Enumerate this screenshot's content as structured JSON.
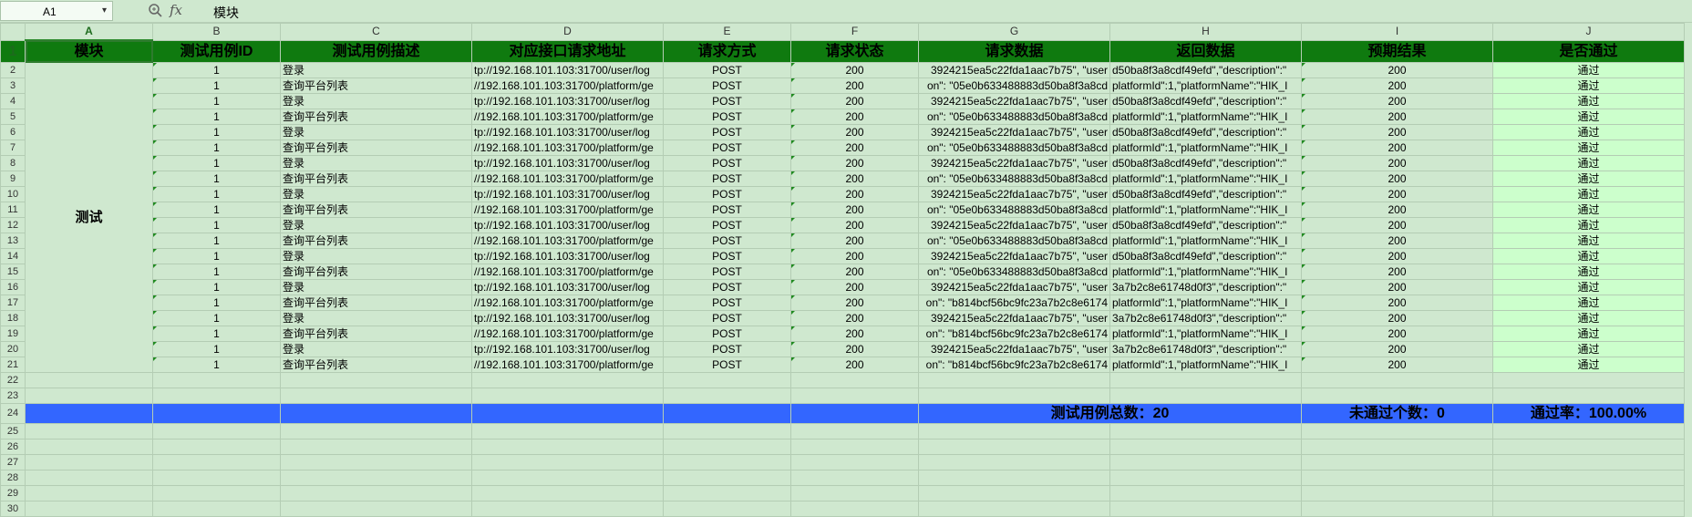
{
  "formula_bar": {
    "cell_ref": "A1",
    "dropdown_icon": "chevron-down",
    "zoom_icon": "magnifier",
    "fx_label": "fx",
    "value": "模块"
  },
  "columns": [
    "A",
    "B",
    "C",
    "D",
    "E",
    "F",
    "G",
    "H",
    "I",
    "J"
  ],
  "header": [
    "模块",
    "测试用例ID",
    "测试用例描述",
    "对应接口请求地址",
    "请求方式",
    "请求状态",
    "请求数据",
    "返回数据",
    "预期结果",
    "是否通过"
  ],
  "module_label": "测试",
  "rows": [
    {
      "num": "2",
      "id": "1",
      "desc": "登录",
      "url": "tp://192.168.101.103:31700/user/log",
      "method": "POST",
      "status": "200",
      "req": "3924215ea5c22fda1aac7b75\", \"user",
      "resp": "d50ba8f3a8cdf49efd\",\"description\":\"",
      "expected": "200",
      "pass": "通过"
    },
    {
      "num": "3",
      "id": "1",
      "desc": "查询平台列表",
      "url": "//192.168.101.103:31700/platform/ge",
      "method": "POST",
      "status": "200",
      "req": "on\": \"05e0b633488883d50ba8f3a8cd",
      "resp": "platformId\":1,\"platformName\":\"HIK_I",
      "expected": "200",
      "pass": "通过"
    },
    {
      "num": "4",
      "id": "1",
      "desc": "登录",
      "url": "tp://192.168.101.103:31700/user/log",
      "method": "POST",
      "status": "200",
      "req": "3924215ea5c22fda1aac7b75\", \"user",
      "resp": "d50ba8f3a8cdf49efd\",\"description\":\"",
      "expected": "200",
      "pass": "通过"
    },
    {
      "num": "5",
      "id": "1",
      "desc": "查询平台列表",
      "url": "//192.168.101.103:31700/platform/ge",
      "method": "POST",
      "status": "200",
      "req": "on\": \"05e0b633488883d50ba8f3a8cd",
      "resp": "platformId\":1,\"platformName\":\"HIK_I",
      "expected": "200",
      "pass": "通过"
    },
    {
      "num": "6",
      "id": "1",
      "desc": "登录",
      "url": "tp://192.168.101.103:31700/user/log",
      "method": "POST",
      "status": "200",
      "req": "3924215ea5c22fda1aac7b75\", \"user",
      "resp": "d50ba8f3a8cdf49efd\",\"description\":\"",
      "expected": "200",
      "pass": "通过"
    },
    {
      "num": "7",
      "id": "1",
      "desc": "查询平台列表",
      "url": "//192.168.101.103:31700/platform/ge",
      "method": "POST",
      "status": "200",
      "req": "on\": \"05e0b633488883d50ba8f3a8cd",
      "resp": "platformId\":1,\"platformName\":\"HIK_I",
      "expected": "200",
      "pass": "通过"
    },
    {
      "num": "8",
      "id": "1",
      "desc": "登录",
      "url": "tp://192.168.101.103:31700/user/log",
      "method": "POST",
      "status": "200",
      "req": "3924215ea5c22fda1aac7b75\", \"user",
      "resp": "d50ba8f3a8cdf49efd\",\"description\":\"",
      "expected": "200",
      "pass": "通过"
    },
    {
      "num": "9",
      "id": "1",
      "desc": "查询平台列表",
      "url": "//192.168.101.103:31700/platform/ge",
      "method": "POST",
      "status": "200",
      "req": "on\": \"05e0b633488883d50ba8f3a8cd",
      "resp": "platformId\":1,\"platformName\":\"HIK_I",
      "expected": "200",
      "pass": "通过"
    },
    {
      "num": "10",
      "id": "1",
      "desc": "登录",
      "url": "tp://192.168.101.103:31700/user/log",
      "method": "POST",
      "status": "200",
      "req": "3924215ea5c22fda1aac7b75\", \"user",
      "resp": "d50ba8f3a8cdf49efd\",\"description\":\"",
      "expected": "200",
      "pass": "通过"
    },
    {
      "num": "11",
      "id": "1",
      "desc": "查询平台列表",
      "url": "//192.168.101.103:31700/platform/ge",
      "method": "POST",
      "status": "200",
      "req": "on\": \"05e0b633488883d50ba8f3a8cd",
      "resp": "platformId\":1,\"platformName\":\"HIK_I",
      "expected": "200",
      "pass": "通过"
    },
    {
      "num": "12",
      "id": "1",
      "desc": "登录",
      "url": "tp://192.168.101.103:31700/user/log",
      "method": "POST",
      "status": "200",
      "req": "3924215ea5c22fda1aac7b75\", \"user",
      "resp": "d50ba8f3a8cdf49efd\",\"description\":\"",
      "expected": "200",
      "pass": "通过"
    },
    {
      "num": "13",
      "id": "1",
      "desc": "查询平台列表",
      "url": "//192.168.101.103:31700/platform/ge",
      "method": "POST",
      "status": "200",
      "req": "on\": \"05e0b633488883d50ba8f3a8cd",
      "resp": "platformId\":1,\"platformName\":\"HIK_I",
      "expected": "200",
      "pass": "通过"
    },
    {
      "num": "14",
      "id": "1",
      "desc": "登录",
      "url": "tp://192.168.101.103:31700/user/log",
      "method": "POST",
      "status": "200",
      "req": "3924215ea5c22fda1aac7b75\", \"user",
      "resp": "d50ba8f3a8cdf49efd\",\"description\":\"",
      "expected": "200",
      "pass": "通过"
    },
    {
      "num": "15",
      "id": "1",
      "desc": "查询平台列表",
      "url": "//192.168.101.103:31700/platform/ge",
      "method": "POST",
      "status": "200",
      "req": "on\": \"05e0b633488883d50ba8f3a8cd",
      "resp": "platformId\":1,\"platformName\":\"HIK_I",
      "expected": "200",
      "pass": "通过"
    },
    {
      "num": "16",
      "id": "1",
      "desc": "登录",
      "url": "tp://192.168.101.103:31700/user/log",
      "method": "POST",
      "status": "200",
      "req": "3924215ea5c22fda1aac7b75\", \"user",
      "resp": "3a7b2c8e61748d0f3\",\"description\":\"",
      "expected": "200",
      "pass": "通过"
    },
    {
      "num": "17",
      "id": "1",
      "desc": "查询平台列表",
      "url": "//192.168.101.103:31700/platform/ge",
      "method": "POST",
      "status": "200",
      "req": "on\": \"b814bcf56bc9fc23a7b2c8e6174",
      "resp": "platformId\":1,\"platformName\":\"HIK_I",
      "expected": "200",
      "pass": "通过"
    },
    {
      "num": "18",
      "id": "1",
      "desc": "登录",
      "url": "tp://192.168.101.103:31700/user/log",
      "method": "POST",
      "status": "200",
      "req": "3924215ea5c22fda1aac7b75\", \"user",
      "resp": "3a7b2c8e61748d0f3\",\"description\":\"",
      "expected": "200",
      "pass": "通过"
    },
    {
      "num": "19",
      "id": "1",
      "desc": "查询平台列表",
      "url": "//192.168.101.103:31700/platform/ge",
      "method": "POST",
      "status": "200",
      "req": "on\": \"b814bcf56bc9fc23a7b2c8e6174",
      "resp": "platformId\":1,\"platformName\":\"HIK_I",
      "expected": "200",
      "pass": "通过"
    },
    {
      "num": "20",
      "id": "1",
      "desc": "登录",
      "url": "tp://192.168.101.103:31700/user/log",
      "method": "POST",
      "status": "200",
      "req": "3924215ea5c22fda1aac7b75\", \"user",
      "resp": "3a7b2c8e61748d0f3\",\"description\":\"",
      "expected": "200",
      "pass": "通过"
    },
    {
      "num": "21",
      "id": "1",
      "desc": "查询平台列表",
      "url": "//192.168.101.103:31700/platform/ge",
      "method": "POST",
      "status": "200",
      "req": "on\": \"b814bcf56bc9fc23a7b2c8e6174",
      "resp": "platformId\":1,\"platformName\":\"HIK_I",
      "expected": "200",
      "pass": "通过"
    }
  ],
  "empty_rows_before_summary": [
    "22",
    "23"
  ],
  "summary": {
    "row_num": "24",
    "total_label": "测试用例总数：20",
    "failed_label": "未通过个数：0",
    "pass_rate_label": "通过率：100.00%"
  },
  "empty_rows_after_summary": [
    "25",
    "26",
    "27",
    "28",
    "29",
    "30"
  ],
  "colors": {
    "header_bg": "#0f7a0f",
    "summary_bg": "#3366ff",
    "pass_bg": "#ccffcc",
    "sheet_bg": "#cfe8cf"
  }
}
